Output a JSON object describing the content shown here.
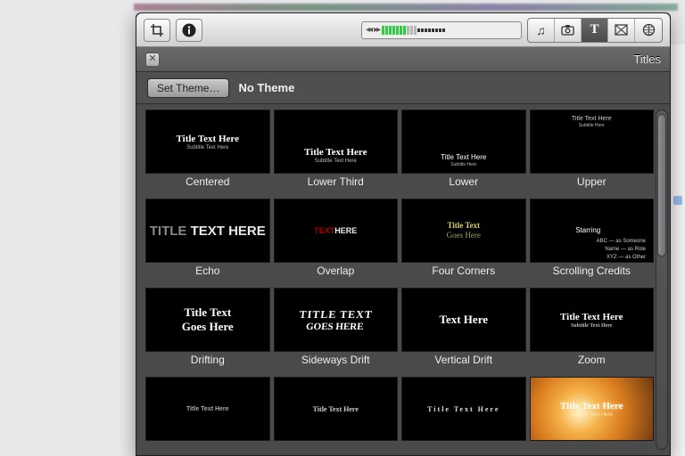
{
  "toolbar": {
    "crop_btn": "crop",
    "info_btn": "info",
    "music_btn": "music",
    "photo_btn": "photo",
    "titles_btn": "titles",
    "transitions_btn": "transitions",
    "maps_btn": "maps"
  },
  "panel": {
    "title": "Titles",
    "close_label": "✕",
    "set_theme_btn": "Set Theme…",
    "theme_name": "No Theme"
  },
  "titles": [
    {
      "name": "Centered",
      "line1": "Title Text Here",
      "line2": "Subtitle Text Here",
      "style": "centered"
    },
    {
      "name": "Lower Third",
      "line1": "Title Text Here",
      "line2": "Subtitle Text Here",
      "style": "lower-third"
    },
    {
      "name": "Lower",
      "line1": "Title Text Here",
      "line2": "Subtitle Here",
      "style": "lower"
    },
    {
      "name": "Upper",
      "line1": "Title Text Here",
      "line2": "Subtitle Here",
      "style": "upper"
    },
    {
      "name": "Echo",
      "line1": "TITLE TEXT HERE",
      "line2": "",
      "style": "echo"
    },
    {
      "name": "Overlap",
      "line1": "TEXT HERE",
      "line2": "",
      "style": "overlap"
    },
    {
      "name": "Four Corners",
      "line1": "Title Text",
      "line2": "Goes Here",
      "style": "fourcorners"
    },
    {
      "name": "Scrolling Credits",
      "heading": "Starring",
      "rows": [
        "ABC — as Someone",
        "Name — as Role",
        "XYZ — as Other"
      ],
      "style": "credits"
    },
    {
      "name": "Drifting",
      "line1": "Title Text",
      "line2": "Goes Here",
      "style": "drifting"
    },
    {
      "name": "Sideways Drift",
      "line1": "TITLE TEXT",
      "line2": "GOES HERE",
      "style": "sdrift"
    },
    {
      "name": "Vertical Drift",
      "line1": "Text Here",
      "line2": "",
      "style": "vdrift"
    },
    {
      "name": "Zoom",
      "line1": "Title Text Here",
      "line2": "Subtitle Text Here",
      "style": "zoom"
    },
    {
      "name": "",
      "line1": "Title Text Here",
      "line2": "",
      "style": "row4a"
    },
    {
      "name": "",
      "line1": "Title Text Here",
      "line2": "",
      "style": "row4b"
    },
    {
      "name": "",
      "line1": "Title Text Here",
      "line2": "",
      "style": "row4c"
    },
    {
      "name": "",
      "line1": "Title Text Here",
      "line2": "Subtitle Text Here",
      "style": "lensflare"
    }
  ]
}
